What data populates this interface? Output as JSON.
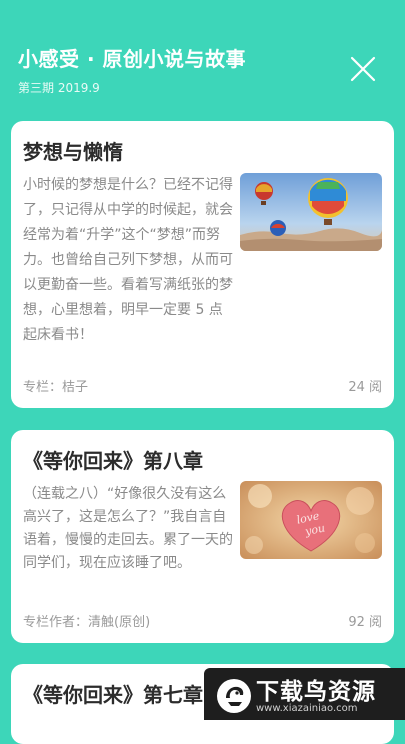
{
  "header": {
    "app_title": "小感受 · 原创小说与故事",
    "issue": "第三期 2019.9"
  },
  "articles": [
    {
      "title": "梦想与懒惰",
      "excerpt": "小时候的梦想是什么？已经不记得了，只记得从中学的时候起，就会经常为着“升学”这个“梦想”而努力。也曾给自己列下梦想，从而可以更勤奋一些。看着写满纸张的梦想，心里想着，明早一定要 5 点起床看书！",
      "author": "专栏：桔子",
      "reads": "24 阅",
      "image_icon": "hot-air-balloons"
    },
    {
      "title": "《等你回来》第八章",
      "excerpt": "（连载之八）“好像很久没有这么高兴了，这是怎么了？”我自言自语着，慢慢的走回去。累了一天的同学们，现在应该睡了吧。",
      "author": "专栏作者：清触(原创)",
      "reads": "92 阅",
      "image_icon": "love-you-heart"
    },
    {
      "title": "《等你回来》第七章"
    }
  ],
  "watermark": {
    "brand": "下载鸟资源",
    "url": "www.xiazainiao.com"
  },
  "colors": {
    "background": "#3dd6b9",
    "card": "#ffffff",
    "title_text": "#2c2c2c",
    "body_text": "#8a8a8a",
    "meta_text": "#9a9a9a"
  }
}
